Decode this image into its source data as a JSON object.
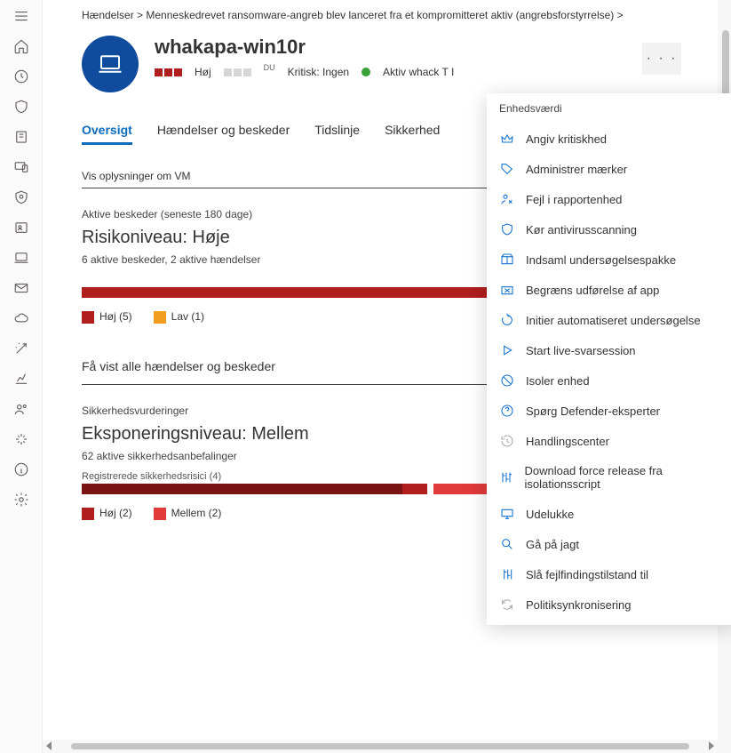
{
  "crumbs": {
    "a": "Hændelser >",
    "b": "Menneskedrevet ransomware-angreb blev lanceret fra et kompromitteret aktiv (angrebsforstyrrelse) >"
  },
  "device": {
    "name": "whakapa-win10r",
    "sev_label": "Høj",
    "du": "DU",
    "crit_label": "Kritisk: Ingen",
    "active_label": "Aktiv whack T I"
  },
  "tabs": {
    "t0": "Oversigt",
    "t1": "Hændelser og beskeder",
    "t2": "Tidslinje",
    "t3": "Sikkerhed"
  },
  "vm_link": "Vis oplysninger om VM",
  "risk": {
    "subhead": "Aktive beskeder (seneste 180 dage)",
    "title": "Risikoniveau: Høje",
    "meta": "6 aktive beskeder, 2 aktive hændelser",
    "legend_hoj": "Høj (5)",
    "legend_lav": "Lav (1)"
  },
  "all_events_link": "Få vist alle hændelser og beskeder",
  "exposure": {
    "subhead": "Sikkerhedsvurderinger",
    "title": "Eksponeringsniveau: Mellem",
    "meta": "62 aktive sikkerhedsanbefalinger",
    "bar_label": "Registrerede sikkerhedsrisici (4)",
    "legend_hoj": "Høj (2)",
    "legend_mel": "Mellem (2)"
  },
  "aktiv_besk": "Aktive beskeder",
  "menu": {
    "header": "Enhedsværdi",
    "items": [
      {
        "icon": "crown",
        "label": "Angiv kritiskhed"
      },
      {
        "icon": "tag",
        "label": "Administrer mærker"
      },
      {
        "icon": "person-fail",
        "label": "Fejl i rapportenhed"
      },
      {
        "icon": "shield",
        "label": "Kør antivirusscanning"
      },
      {
        "icon": "package",
        "label": "Indsaml undersøgelsespakke"
      },
      {
        "icon": "restrict",
        "label": "Begræns udførelse af app"
      },
      {
        "icon": "cycle",
        "label": "Initier automatiseret undersøgelse"
      },
      {
        "icon": "play",
        "label": "Start live-svarsession"
      },
      {
        "icon": "block",
        "label": "Isoler enhed"
      },
      {
        "icon": "question",
        "label": "Spørg Defender-eksperter"
      },
      {
        "icon": "history",
        "label": "Handlingscenter",
        "grey": true
      },
      {
        "icon": "sliders",
        "label": "Download force release fra isolationsscript"
      },
      {
        "icon": "monitor",
        "label": "Udelukke"
      },
      {
        "icon": "hunt",
        "label": "Gå på jagt"
      },
      {
        "icon": "debug",
        "label": "Slå fejlfindingstilstand til"
      },
      {
        "icon": "sync",
        "label": "Politiksynkronisering",
        "grey": true
      }
    ]
  }
}
